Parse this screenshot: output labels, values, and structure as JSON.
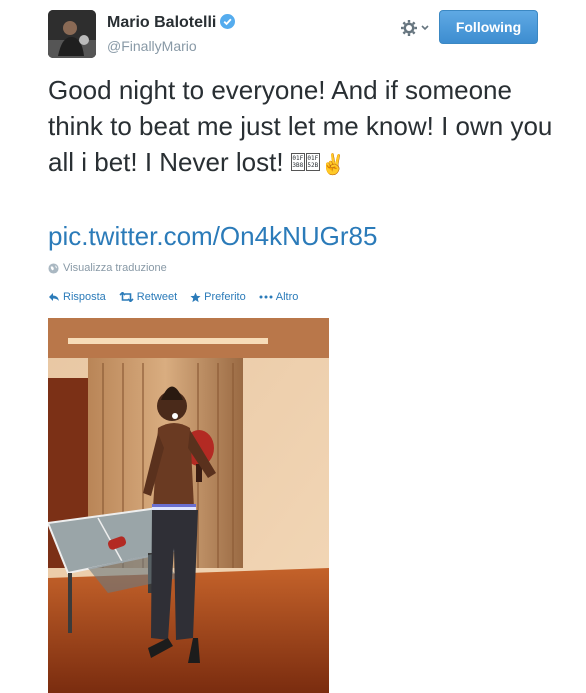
{
  "user": {
    "name": "Mario Balotelli",
    "handle": "@FinallyMario",
    "verified": true
  },
  "header": {
    "follow_label": "Following",
    "gear_icon": "gear-icon",
    "colors": {
      "follow_button": "#3d8dd0",
      "link": "#2b7bb9"
    }
  },
  "tweet": {
    "text_main": "Good night to everyone! And if someone think to beat me just let me know! I own you all i bet! I Never lost!",
    "emoji": [
      {
        "icon": "ping-pong-paddle-emoji",
        "lines": [
          "01F",
          "3B8"
        ]
      },
      {
        "icon": "ping-pong-paddle-emoji",
        "lines": [
          "01F",
          "52B"
        ]
      },
      {
        "icon": "victory-hand-emoji",
        "glyph": "✌"
      }
    ],
    "link": "pic.twitter.com/On4kNUGr85",
    "translate_label": "Visualizza traduzione"
  },
  "actions": {
    "reply": "Risposta",
    "retweet": "Retweet",
    "favorite": "Preferito",
    "more": "Altro"
  },
  "photo": {
    "subject": "man holding a table-tennis paddle next to a ping-pong table in a warmly lit room"
  }
}
